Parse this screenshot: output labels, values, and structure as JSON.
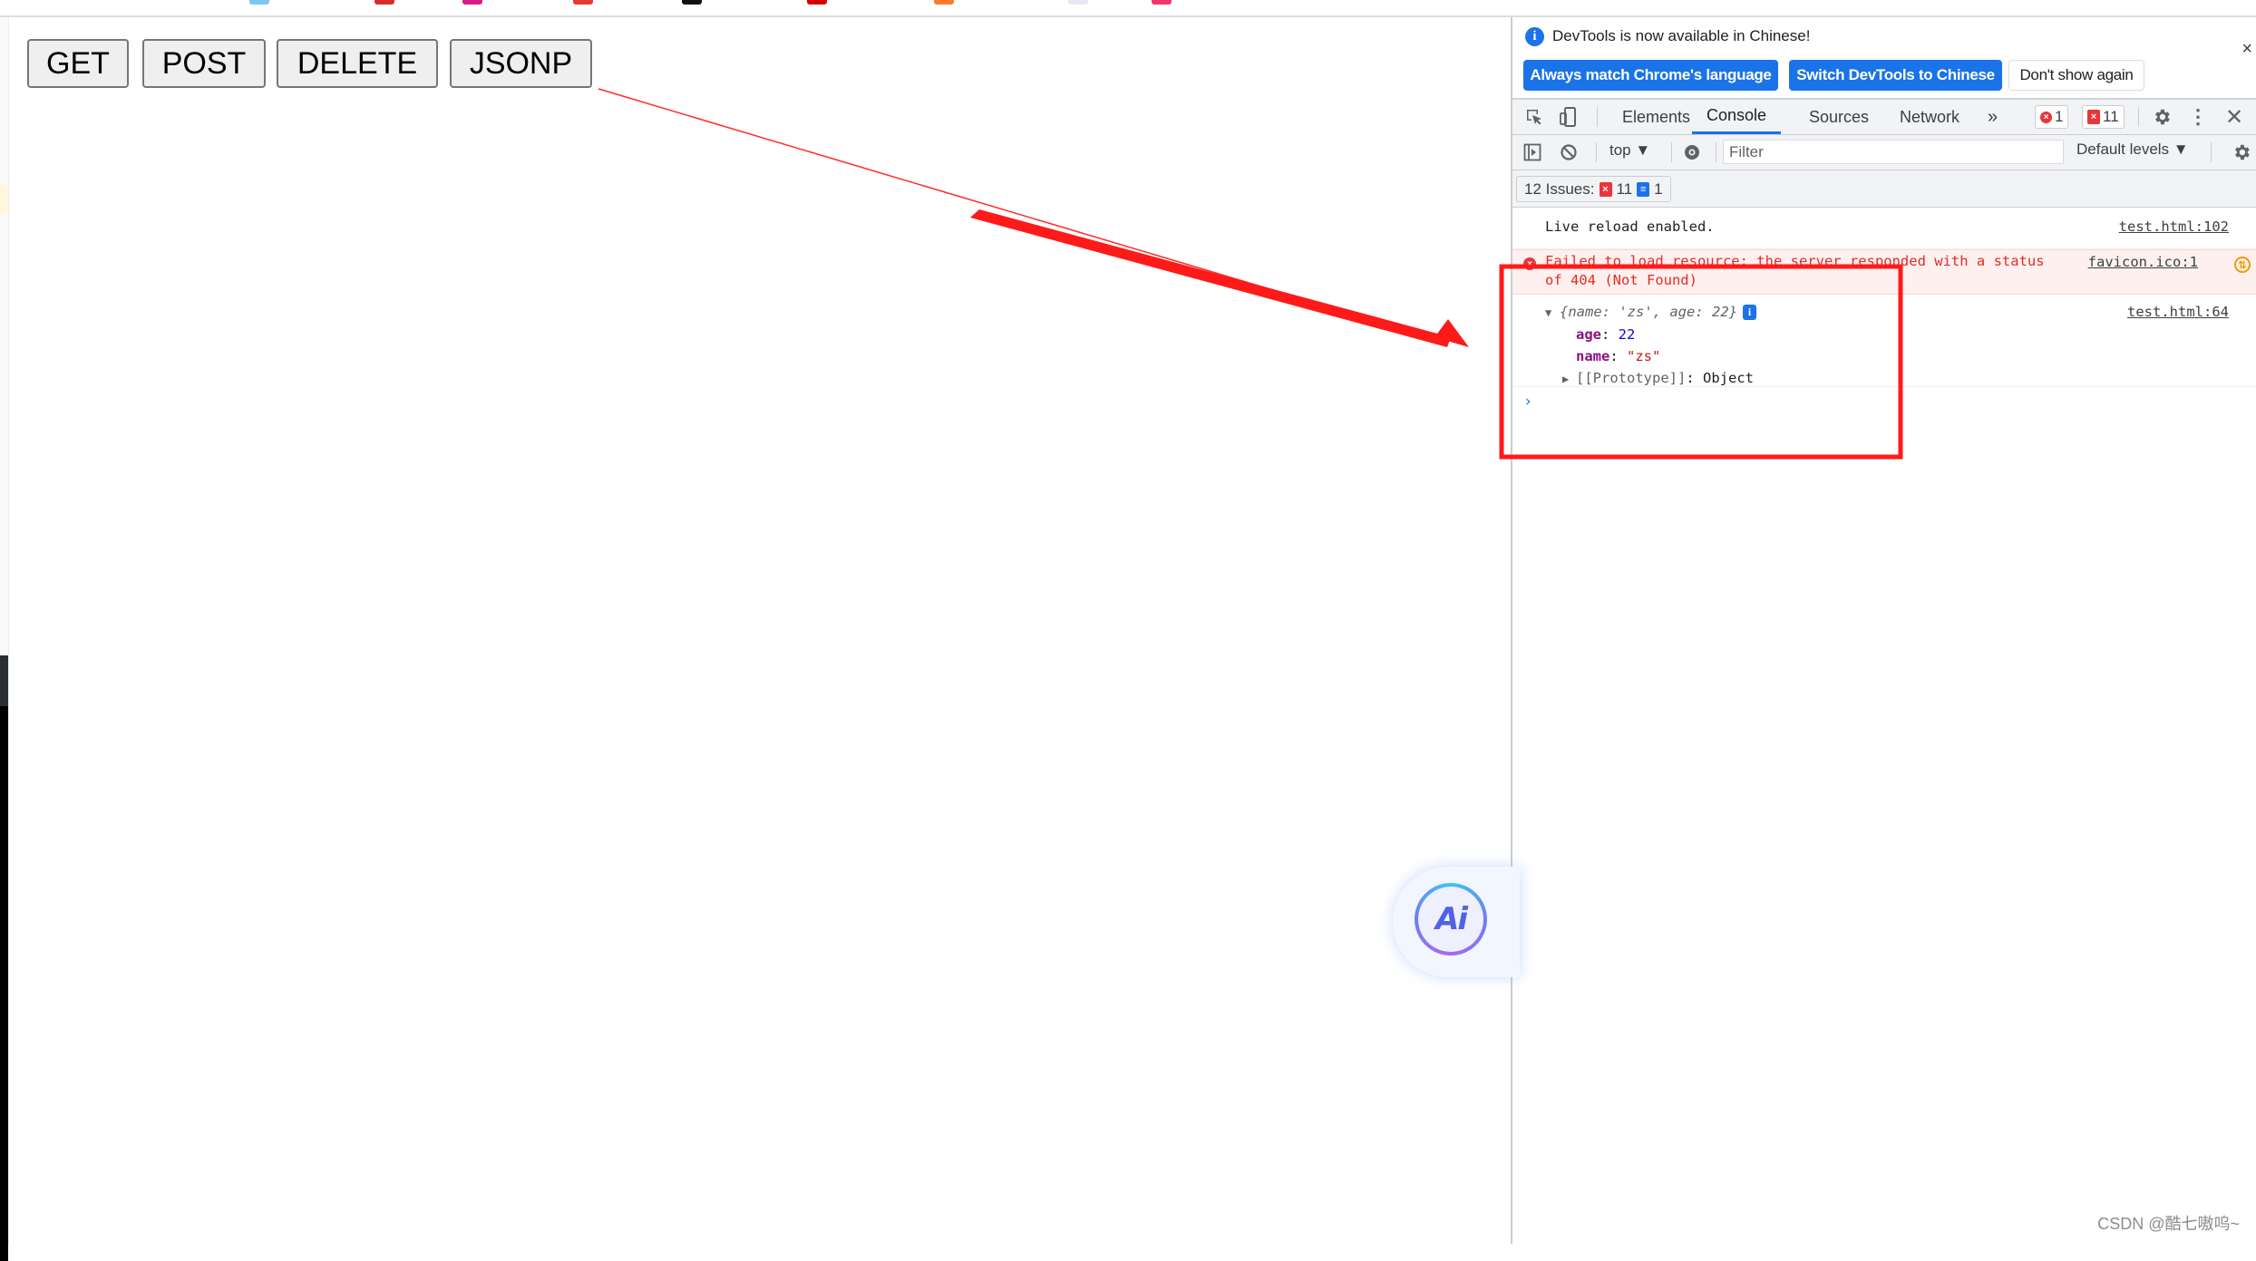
{
  "page": {
    "buttons": [
      "GET",
      "POST",
      "DELETE",
      "JSONP"
    ]
  },
  "tab_strip": {
    "favicon_colors": [
      "#7cc6f2",
      "#d32f2f",
      "#d81b8a",
      "#e53935",
      "#111111",
      "#d50000",
      "#ff7a2f",
      "#e6e9f5",
      "#f0376a"
    ]
  },
  "devtools": {
    "infobar": {
      "message": "DevTools is now available in Chinese!",
      "buttons": {
        "match": "Always match Chrome's language",
        "switch": "Switch DevTools to Chinese",
        "dismiss": "Don't show again"
      },
      "close": "×"
    },
    "tabs": [
      "Elements",
      "Console",
      "Sources",
      "Network"
    ],
    "active_tab": "Console",
    "more_tabs": "»",
    "error_count": "1",
    "issue_count": "11",
    "toolbar": {
      "context": "top ▼",
      "filter_placeholder": "Filter",
      "levels": "Default levels ▼"
    },
    "issues": {
      "label": "12 Issues:",
      "errors": "11",
      "info": "1"
    },
    "console": {
      "rows": [
        {
          "type": "log",
          "text": "Live reload enabled.",
          "source": "test.html:102"
        },
        {
          "type": "error",
          "text_line1": "Failed to load resource: the server responded with a status",
          "text_line2": "of 404 (Not Found)",
          "source": "favicon.ico:1"
        },
        {
          "type": "object",
          "source": "test.html:64",
          "summary": {
            "open": "{",
            "k1": "name",
            "v1": "'zs'",
            "k2": "age",
            "v2": "22",
            "close": "}"
          },
          "props": [
            {
              "key": "age",
              "value": "22",
              "kind": "number"
            },
            {
              "key": "name",
              "value": "\"zs\"",
              "kind": "string"
            }
          ],
          "prototype": {
            "key": "[[Prototype]]",
            "value": "Object"
          }
        }
      ],
      "prompt": "›"
    }
  },
  "ai_button": {
    "label": "Ai"
  },
  "watermark": "CSDN @酷七嗷呜~",
  "annotation": {
    "color": "#ff1a1a"
  }
}
